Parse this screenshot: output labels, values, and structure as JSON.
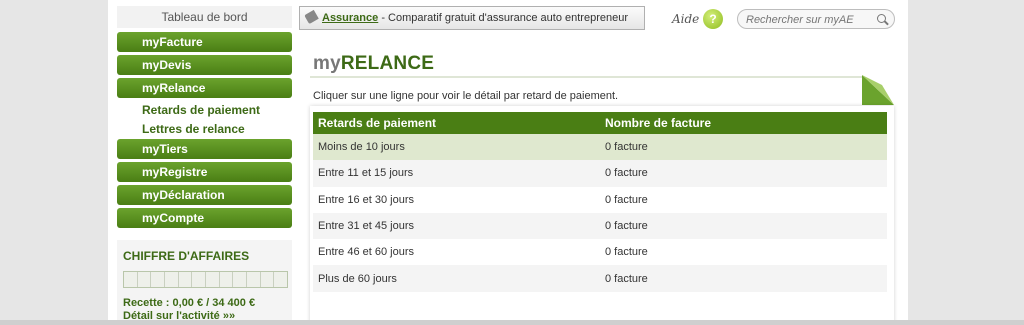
{
  "sidebar": {
    "dashboard": "Tableau de bord",
    "items": [
      {
        "label": "myFacture"
      },
      {
        "label": "myDevis"
      },
      {
        "label": "myRelance"
      },
      {
        "label": "myTiers"
      },
      {
        "label": "myRegistre"
      },
      {
        "label": "myDéclaration"
      },
      {
        "label": "myCompte"
      }
    ],
    "sub_items": [
      "Retards de paiement",
      "Lettres de relance"
    ],
    "chiffre_affaires": {
      "title": "CHIFFRE D'AFFAIRES",
      "progress": 0,
      "recette": "Recette : 0,00 € / 34 400 €",
      "detail": "Détail sur l'activité »»"
    }
  },
  "topbar": {
    "ad_link": "Assurance",
    "ad_text": " - Comparatif gratuit d'assurance auto entrepreneur",
    "help_label": "Aide",
    "help_icon": "?",
    "search_placeholder": "Rechercher sur myAE"
  },
  "main": {
    "title_prefix": "my",
    "title_main": "RELANCE",
    "hint": "Cliquer sur une ligne pour voir le détail par retard de paiement.",
    "columns": [
      "Retards de paiement",
      "Nombre de facture"
    ],
    "rows": [
      [
        "Moins de 10 jours",
        "0 facture"
      ],
      [
        "Entre 11 et 15 jours",
        "0 facture"
      ],
      [
        "Entre 16 et 30 jours",
        "0 facture"
      ],
      [
        "Entre 31 et 45 jours",
        "0 facture"
      ],
      [
        "Entre 46 et 60 jours",
        "0 facture"
      ],
      [
        "Plus de 60 jours",
        "0 facture"
      ]
    ]
  },
  "colors": {
    "brand_green": "#4a7e14",
    "active_row": "#dfe8cf"
  }
}
